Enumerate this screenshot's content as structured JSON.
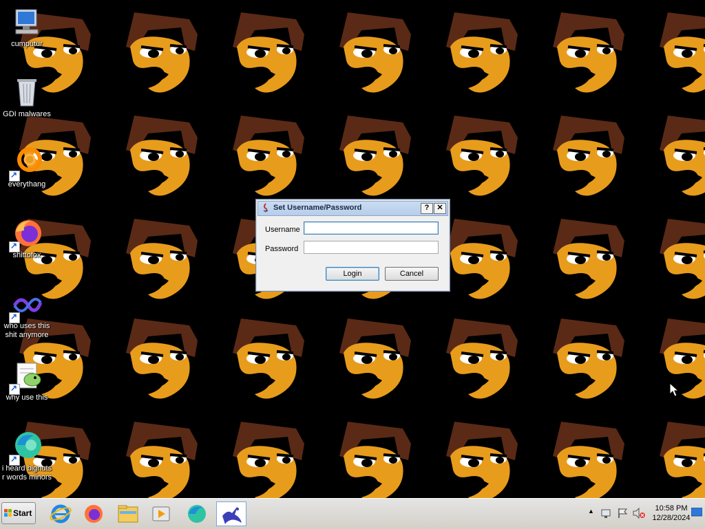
{
  "desktop": {
    "icons": [
      {
        "label": "cumputur"
      },
      {
        "label": "GDI malwares"
      },
      {
        "label": "everythang"
      },
      {
        "label": "shittofox"
      },
      {
        "label": "who uses this shit anymore"
      },
      {
        "label": "why use this"
      },
      {
        "label": "i heard bignuts r words minors"
      }
    ]
  },
  "dialog": {
    "title": "Set Username/Password",
    "help_label": "?",
    "close_label": "✕",
    "username_label": "Username",
    "username_value": "",
    "password_label": "Password",
    "password_value": "",
    "login_label": "Login",
    "cancel_label": "Cancel"
  },
  "taskbar": {
    "start_label": "Start",
    "apps": [
      "internet-explorer-icon",
      "firefox-icon",
      "file-explorer-icon",
      "media-player-icon",
      "edge-icon",
      "java-app-icon"
    ],
    "tray_up_arrow": "▲",
    "time": "10:58 PM",
    "date": "12/28/2024"
  },
  "colors": {
    "wallpaper_bg": "#000000",
    "hat_brown": "#5a2a16",
    "face_orange": "#e89c1c"
  }
}
